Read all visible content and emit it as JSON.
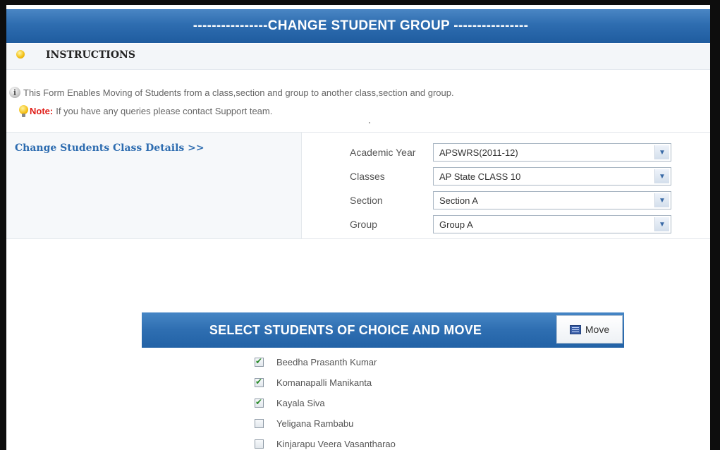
{
  "header": {
    "title": "----------------CHANGE STUDENT GROUP ----------------"
  },
  "instructions": {
    "label": "INSTRUCTIONS",
    "info_text": "This Form Enables Moving of Students from a class,section and group to another class,section and group.",
    "note_label": "Note:",
    "note_text": "If you have any queries please contact Support team."
  },
  "details": {
    "link": "Change Students Class Details >>",
    "fields": [
      {
        "label": "Academic Year",
        "value": "APSWRS(2011-12)"
      },
      {
        "label": "Classes",
        "value": "AP State CLASS 10"
      },
      {
        "label": "Section",
        "value": "Section A"
      },
      {
        "label": "Group",
        "value": "Group A"
      }
    ]
  },
  "students": {
    "title": "SELECT STUDENTS OF CHOICE AND MOVE",
    "move_label": "Move",
    "items": [
      {
        "name": "Beedha Prasanth Kumar",
        "checked": true
      },
      {
        "name": "Komanapalli Manikanta",
        "checked": true
      },
      {
        "name": "Kayala Siva",
        "checked": true
      },
      {
        "name": "Yeligana Rambabu",
        "checked": false
      },
      {
        "name": "Kinjarapu Veera Vasantharao",
        "checked": false
      }
    ]
  },
  "colors": {
    "accent": "#2e6db0",
    "link": "#2d6cb0",
    "note": "#e0201b",
    "check": "#2a8a2a"
  }
}
